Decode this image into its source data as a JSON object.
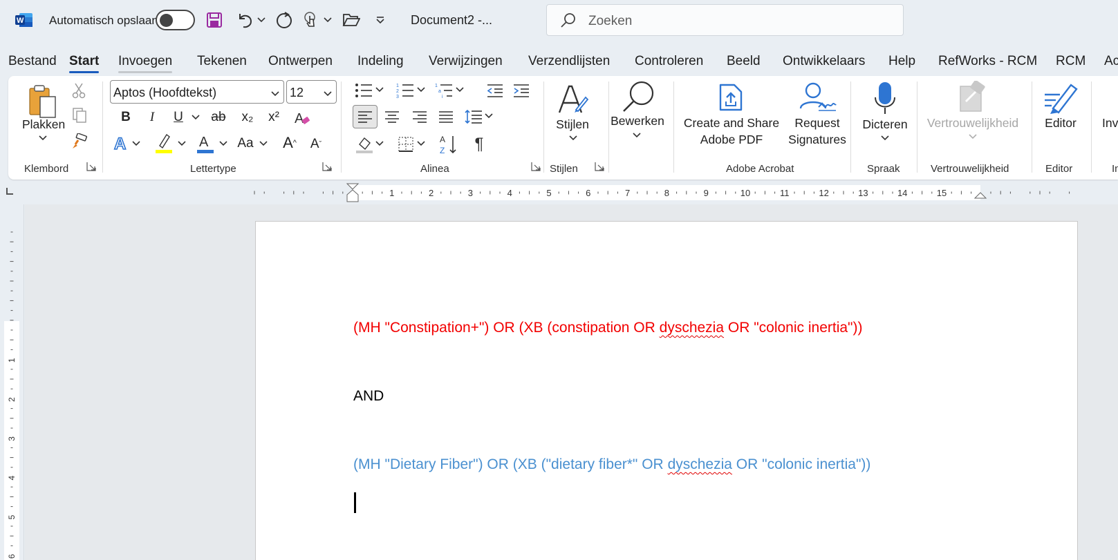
{
  "titlebar": {
    "autosave_label": "Automatisch opslaan",
    "doc_title": "Document2  -...",
    "search_placeholder": "Zoeken",
    "app_color": "#185abd",
    "save_icon_color": "#9a2aa0"
  },
  "tabs": [
    "Bestand",
    "Start",
    "Invoegen",
    "Tekenen",
    "Ontwerpen",
    "Indeling",
    "Verwijzingen",
    "Verzendlijsten",
    "Controleren",
    "Beeld",
    "Ontwikkelaars",
    "Help",
    "RefWorks - RCM",
    "RCM",
    "Ac"
  ],
  "active_tab": "Start",
  "ribbon": {
    "clipboard": {
      "paste_label": "Plakken",
      "group_label": "Klembord"
    },
    "font": {
      "name": "Aptos (Hoofdtekst)",
      "size": "12",
      "group_label": "Lettertype",
      "bold": "B",
      "italic": "I",
      "underline": "U",
      "strike": "ab",
      "subscript": "x₂",
      "superscript": "x²",
      "change_case": "Aa",
      "grow": "A",
      "shrink": "A"
    },
    "paragraph": {
      "group_label": "Alinea"
    },
    "styles": {
      "label": "Stijlen",
      "group_label": "Stijlen"
    },
    "editing": {
      "label": "Bewerken"
    },
    "acrobat": {
      "create_share_1": "Create and Share",
      "create_share_2": "Adobe PDF",
      "request_1": "Request",
      "request_2": "Signatures",
      "group_label": "Adobe Acrobat"
    },
    "voice": {
      "label": "Dicteren",
      "group_label": "Spraak"
    },
    "sensitivity": {
      "label": "Vertrouwelijkheid",
      "group_label": "Vertrouwelijkheid"
    },
    "editor": {
      "label": "Editor",
      "group_label": "Editor"
    },
    "partial": {
      "label": "Inv",
      "group_label": "In"
    }
  },
  "ruler": {
    "numbers": [
      "1",
      "2",
      "3",
      "4",
      "5",
      "6",
      "7",
      "8",
      "9",
      "10",
      "11",
      "12",
      "13",
      "14",
      "15"
    ],
    "vnumbers": [
      "1",
      "2",
      "3",
      "4",
      "5",
      "6"
    ]
  },
  "document": {
    "line1": {
      "part1": "(MH \"Constipation+\") OR (XB (constipation OR ",
      "misspelled": "dyschezia",
      "part2": " OR \"colonic inertia\"))",
      "color": "#f20000"
    },
    "line2": "AND",
    "line3": {
      "part1": "(MH \"Dietary Fiber\") OR (XB (\"dietary fiber*\" OR ",
      "misspelled": "dyschezia",
      "part2": " OR \"colonic inertia\"))",
      "color": "#4a90d0"
    }
  }
}
